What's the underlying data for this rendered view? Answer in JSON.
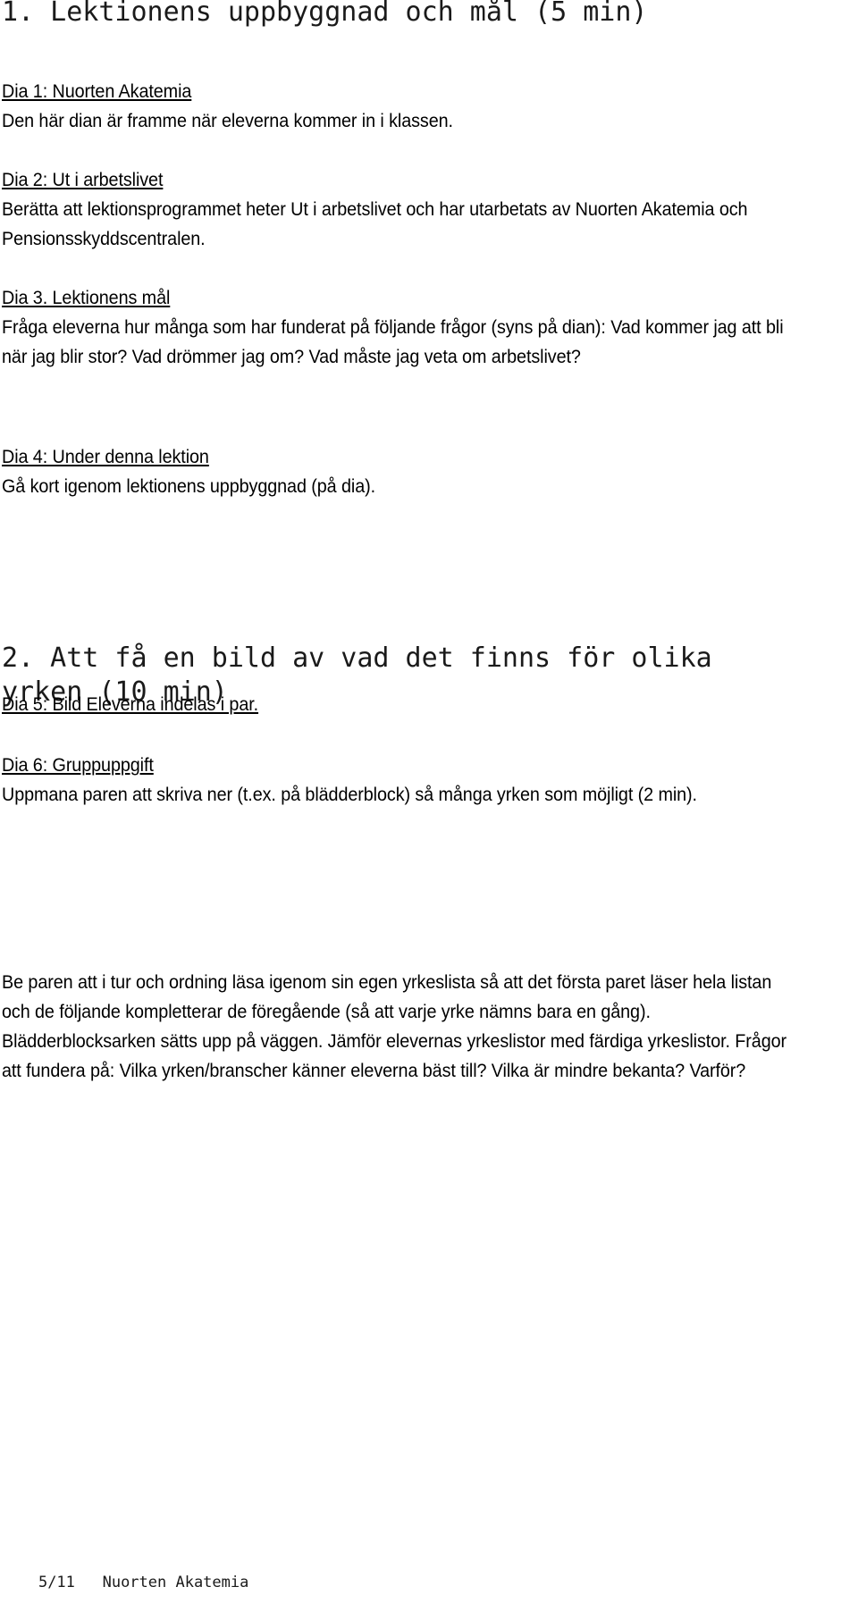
{
  "document": {
    "page_label": "5/11",
    "footer_org": "Nuorten Akatemia",
    "footer_text": "5/11   Nuorten Akatemia"
  },
  "sections": [
    {
      "heading": "1. Lektionens uppbyggnad och mål (5 min)",
      "blocks": [
        {
          "lead": "Dia 1: Nuorten Akatemia",
          "body": "Den här dian är framme när eleverna kommer in i klassen."
        },
        {
          "lead": "Dia 2: Ut i arbetslivet",
          "body": "Berätta att lektionsprogrammet heter Ut i arbetslivet och har utarbetats av Nuorten Akatemia och Pensionsskyddscentralen."
        },
        {
          "lead": "Dia 3. Lektionens mål",
          "body": "Fråga eleverna hur många som har funderat på följande frågor (syns på dian): Vad kommer jag att bli när jag blir stor? Vad drömmer jag om? Vad måste jag veta om arbetslivet?"
        },
        {
          "lead": "Dia 4: Under denna lektion",
          "body": "Gå kort igenom lektionens uppbyggnad (på dia)."
        }
      ]
    },
    {
      "heading": "2. Att få en bild av vad det finns för olika yrken (10 min)",
      "blocks": [
        {
          "lead": "Dia 5: Bild Eleverna indelas i par.",
          "body": ""
        },
        {
          "lead": "Dia 6: Gruppuppgift",
          "body": "Uppmana paren att skriva ner (t.ex. på blädderblock) så många yrken som möjligt (2 min)."
        },
        {
          "lead": "",
          "body": "Be paren att i tur och ordning läsa igenom sin egen yrkeslista så att det första paret läser hela listan och de följande kompletterar de föregående (så att varje yrke nämns bara en gång). Blädderblocksarken sätts upp på väggen. Jämför elevernas yrkeslistor med färdiga yrkeslistor. Frågor att fundera på: Vilka yrken/branscher känner eleverna bäst till? Vilka är mindre bekanta? Varför?"
        }
      ]
    }
  ]
}
